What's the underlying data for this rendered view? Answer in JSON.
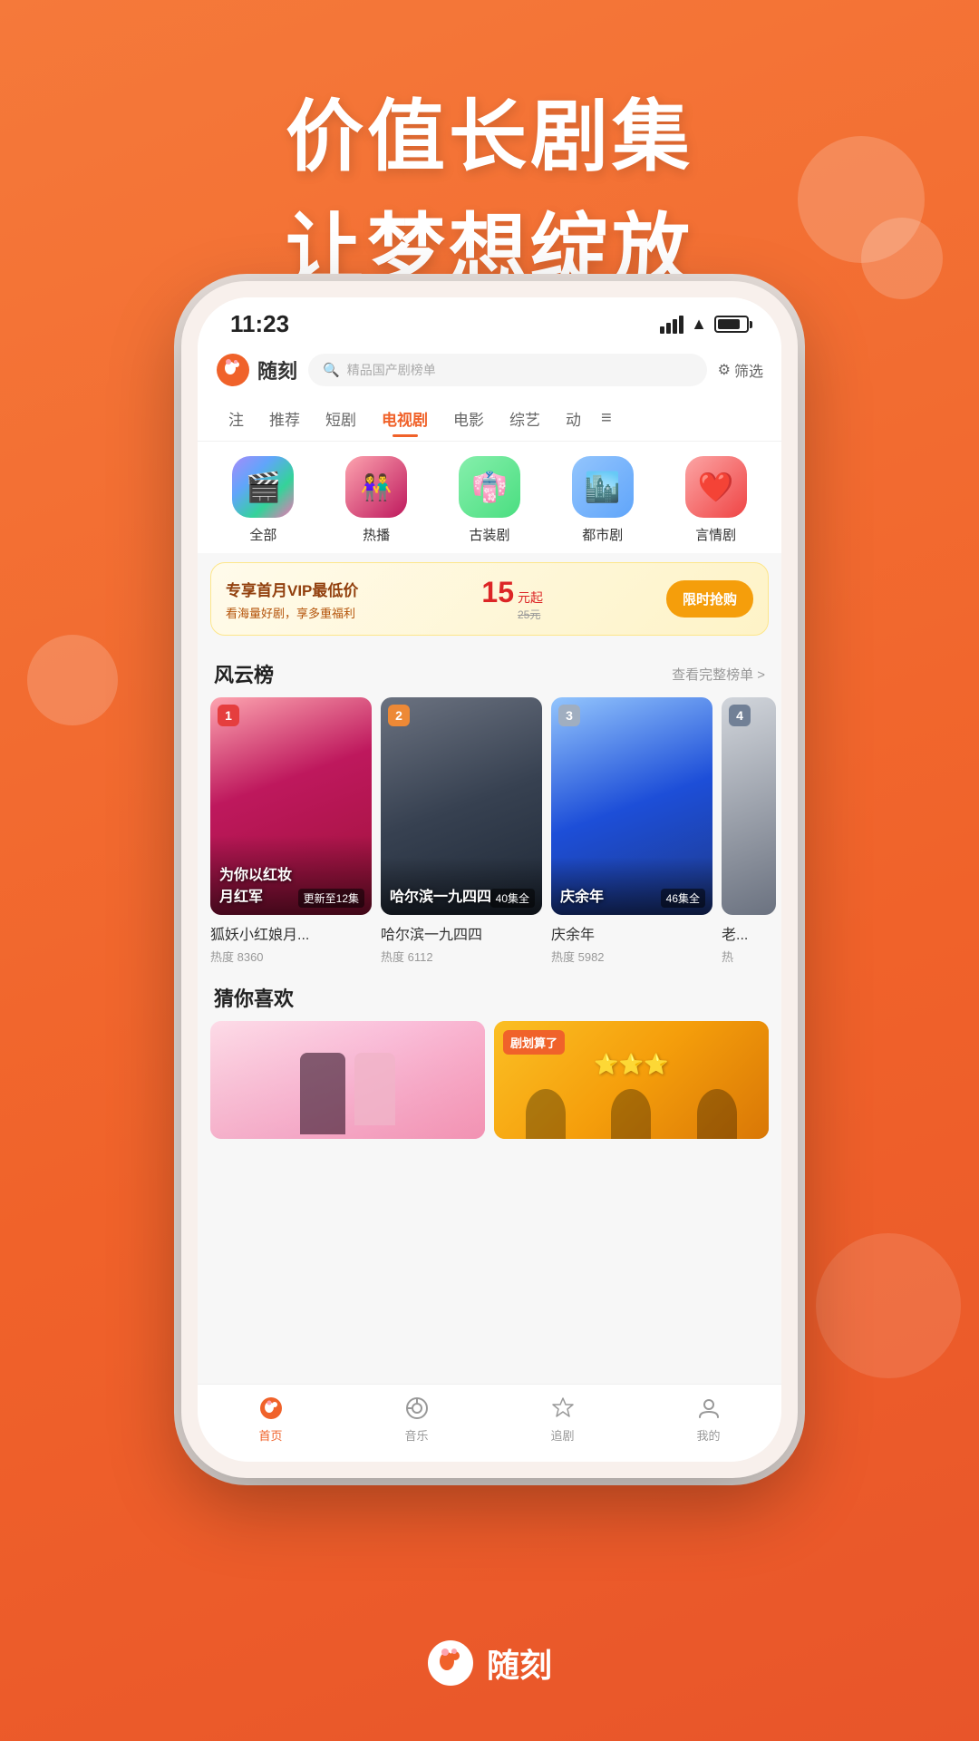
{
  "background": {
    "gradient_start": "#f5793a",
    "gradient_end": "#e8552a"
  },
  "hero": {
    "line1": "价值长剧集",
    "line2": "让梦想绽放"
  },
  "status_bar": {
    "time": "11:23",
    "signal": "signal",
    "wifi": "wifi",
    "battery": "battery"
  },
  "app_header": {
    "logo_text": "随刻",
    "search_placeholder": "精品国产剧榜单",
    "filter_label": "筛选"
  },
  "nav_tabs": [
    {
      "label": "注",
      "active": false
    },
    {
      "label": "推荐",
      "active": false
    },
    {
      "label": "短剧",
      "active": false
    },
    {
      "label": "电视剧",
      "active": true
    },
    {
      "label": "电影",
      "active": false
    },
    {
      "label": "综艺",
      "active": false
    },
    {
      "label": "动",
      "active": false
    },
    {
      "label": "≡",
      "active": false
    }
  ],
  "categories": [
    {
      "label": "全部",
      "icon": "all"
    },
    {
      "label": "热播",
      "icon": "hot"
    },
    {
      "label": "古装剧",
      "icon": "ancient"
    },
    {
      "label": "都市剧",
      "icon": "city"
    },
    {
      "label": "言情剧",
      "icon": "romance"
    }
  ],
  "vip_banner": {
    "title": "专享首月VIP最低价",
    "subtitle": "看海量好剧，享多重福利",
    "price": "15",
    "price_unit": "元起",
    "price_original": "25元",
    "button_label": "限时抢购"
  },
  "rankings": {
    "section_title": "风云榜",
    "section_link": "查看完整榜单 >",
    "items": [
      {
        "rank": "1",
        "title": "狐妖小红娘月...",
        "heat_label": "热度",
        "heat_value": "8360",
        "badge": "更新至12集",
        "poster_color_start": "#fda4af",
        "poster_color_end": "#9f1239",
        "poster_text": "为你以红妆\n月红军"
      },
      {
        "rank": "2",
        "title": "哈尔滨一九四四",
        "heat_label": "热度",
        "heat_value": "6112",
        "badge": "40集全",
        "poster_color_start": "#6b7280",
        "poster_color_end": "#1f2937",
        "poster_text": "哈尔滨一九四四"
      },
      {
        "rank": "3",
        "title": "庆余年",
        "heat_label": "热度",
        "heat_value": "5982",
        "badge": "46集全",
        "poster_color_start": "#93c5fd",
        "poster_color_end": "#1e3a8a",
        "poster_text": "庆余年"
      },
      {
        "rank": "4",
        "title": "老...",
        "heat_label": "热度",
        "heat_value": "热",
        "badge": "",
        "poster_color_start": "#d1d5db",
        "poster_color_end": "#6b7280",
        "poster_text": ""
      }
    ]
  },
  "guess_you_like": {
    "section_title": "猜你喜欢",
    "items": [
      {
        "tag": "",
        "color": "pink"
      },
      {
        "tag": "剧划算了",
        "color": "yellow"
      }
    ]
  },
  "bottom_nav": [
    {
      "label": "首页",
      "active": true,
      "icon": "home"
    },
    {
      "label": "音乐",
      "active": false,
      "icon": "music"
    },
    {
      "label": "追剧",
      "active": false,
      "icon": "star"
    },
    {
      "label": "我的",
      "active": false,
      "icon": "person"
    }
  ],
  "brand": {
    "name": "随刻"
  }
}
